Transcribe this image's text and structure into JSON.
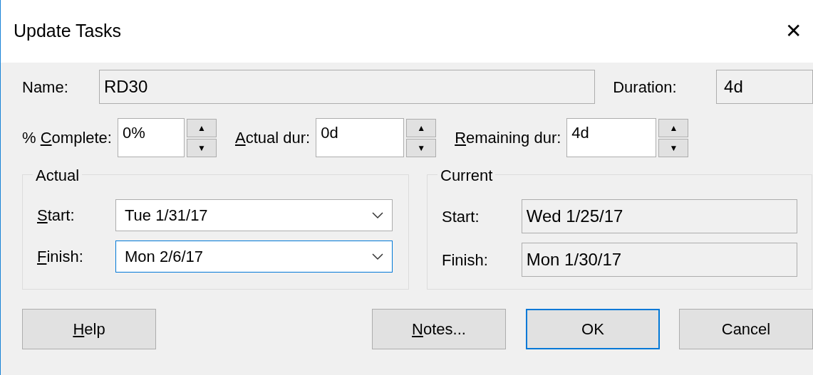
{
  "window": {
    "title": "Update Tasks",
    "close": "✕"
  },
  "name": {
    "label": [
      {
        "text": "Name:",
        "key": false
      }
    ],
    "value": "RD30"
  },
  "duration": {
    "label": [
      {
        "text": "Duration:",
        "key": false
      }
    ],
    "value": "4d"
  },
  "spinners": [
    {
      "label": [
        {
          "text": "% ",
          "key": false
        },
        {
          "text": "C",
          "key": true
        },
        {
          "text": "omplete:",
          "key": false
        }
      ],
      "value": "0%",
      "up": "▲",
      "down": "▼"
    },
    {
      "label": [
        {
          "text": "A",
          "key": true
        },
        {
          "text": "ctual dur:",
          "key": false
        }
      ],
      "value": "0d",
      "up": "▲",
      "down": "▼"
    },
    {
      "label": [
        {
          "text": "R",
          "key": true
        },
        {
          "text": "emaining dur:",
          "key": false
        }
      ],
      "value": "4d",
      "up": "▲",
      "down": "▼"
    }
  ],
  "actual": {
    "title": "Actual",
    "fields": [
      {
        "label": [
          {
            "text": "S",
            "key": true
          },
          {
            "text": "tart:",
            "key": false
          }
        ],
        "value": "Tue 1/31/17",
        "focused": false
      },
      {
        "label": [
          {
            "text": "F",
            "key": true
          },
          {
            "text": "inish:",
            "key": false
          }
        ],
        "value": "Mon 2/6/17",
        "focused": true
      }
    ]
  },
  "current": {
    "title": "Current",
    "fields": [
      {
        "label": [
          {
            "text": "Start:",
            "key": false
          }
        ],
        "value": "Wed 1/25/17"
      },
      {
        "label": [
          {
            "text": "Finish:",
            "key": false
          }
        ],
        "value": "Mon 1/30/17"
      }
    ]
  },
  "buttons": [
    {
      "label": [
        {
          "text": "H",
          "key": true
        },
        {
          "text": "elp",
          "key": false
        }
      ],
      "default": false
    },
    {
      "label": [
        {
          "text": "N",
          "key": true
        },
        {
          "text": "otes...",
          "key": false
        }
      ],
      "default": false
    },
    {
      "label": [
        {
          "text": "OK",
          "key": false
        }
      ],
      "default": true
    },
    {
      "label": [
        {
          "text": "Cancel",
          "key": false
        }
      ],
      "default": false
    }
  ]
}
